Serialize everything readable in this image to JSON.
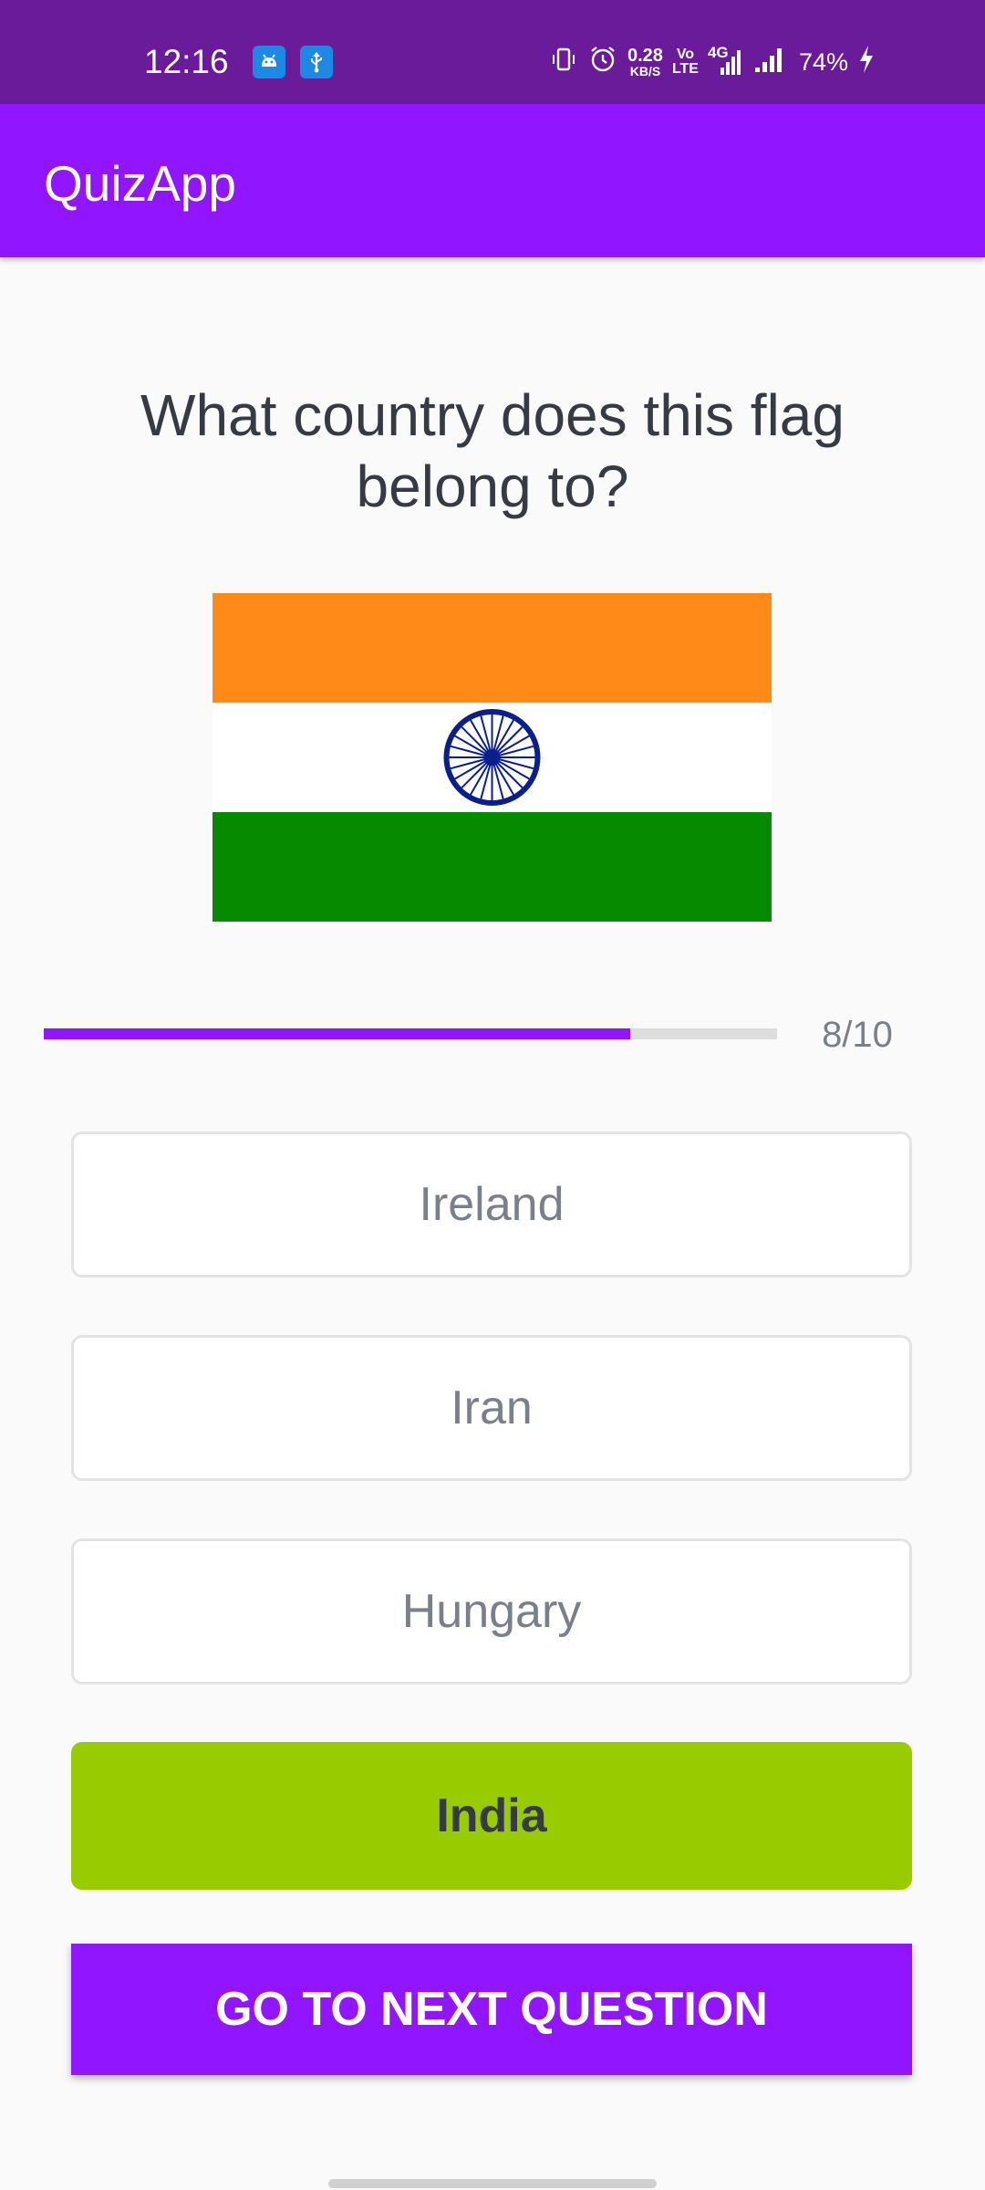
{
  "status_bar": {
    "time": "12:16",
    "net_speed_value": "0.28",
    "net_speed_unit": "KB/S",
    "volte_top": "Vo",
    "volte_bottom": "LTE",
    "network_type": "4G",
    "battery": "74%",
    "icons": [
      "android-debug-icon",
      "usb-icon",
      "vibrate-icon",
      "alarm-icon",
      "signal-icon",
      "signal-icon-2",
      "charging-icon"
    ]
  },
  "app_bar": {
    "title": "QuizApp"
  },
  "question": {
    "text": "What country does this flag belong to?"
  },
  "flag": {
    "icon": "india-flag",
    "colors": {
      "saffron": "#FF8A17",
      "white": "#FFFFFF",
      "green": "#068A00",
      "chakra": "#0A1E8C"
    }
  },
  "progress": {
    "current": 8,
    "total": 10,
    "fraction": 0.8,
    "label": "8/10"
  },
  "options": [
    {
      "label": "Ireland",
      "state": "default"
    },
    {
      "label": "Iran",
      "state": "default"
    },
    {
      "label": "Hungary",
      "state": "default"
    },
    {
      "label": "India",
      "state": "correct"
    }
  ],
  "submit": {
    "label": "GO TO NEXT QUESTION"
  },
  "colors": {
    "primary": "#9215FF",
    "status_bar": "#6A1B9A",
    "correct": "#99CC00",
    "text_dark": "#363A43",
    "text_gray": "#7A8089"
  }
}
